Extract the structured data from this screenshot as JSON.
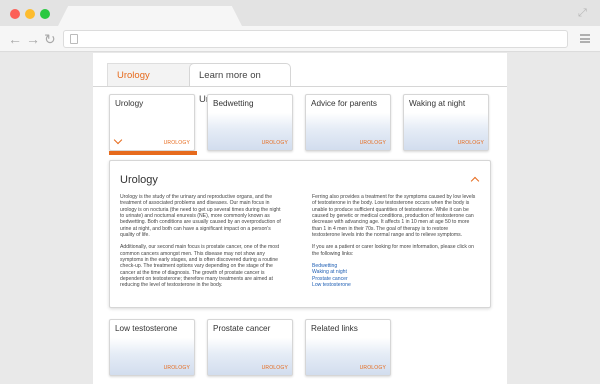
{
  "browser": {
    "window_controls": [
      "close",
      "minimize",
      "maximize"
    ]
  },
  "section_tabs": [
    {
      "label": "Urology products"
    },
    {
      "label": "Learn more on Urology"
    }
  ],
  "cards": [
    {
      "title": "Urology",
      "badge": "UROLOGY"
    },
    {
      "title": "Bedwetting",
      "badge": "UROLOGY"
    },
    {
      "title": "Advice for parents",
      "badge": "UROLOGY"
    },
    {
      "title": "Waking at night",
      "badge": "UROLOGY"
    },
    {
      "title": "Low testosterone",
      "badge": "UROLOGY"
    },
    {
      "title": "Prostate cancer",
      "badge": "UROLOGY"
    },
    {
      "title": "Related links",
      "badge": "UROLOGY"
    }
  ],
  "panel": {
    "title": "Urology",
    "left_p1": "Urology is the study of the urinary and reproductive organs, and the treatment of associated problems and diseases. Our main focus in urology is on nocturia (the need to get up several times during the night to urinate) and nocturnal enuresis (NE), more commonly known as bedwetting. Both conditions are usually caused by an overproduction of urine at night, and both can have a significant impact on a person's quality of life.",
    "left_p2": "Additionally, our second main focus is prostate cancer, one of the most common cancers amongst men. This disease may not show any symptoms in the early stages, and is often discovered during a routine check-up. The treatment options vary depending on the stage of the cancer at the time of diagnosis. The growth of prostate cancer is dependent on testosterone; therefore many treatments are aimed at reducing the level of testosterone in the body.",
    "right_p1": "Ferring also provides a treatment for the symptoms caused by low levels of testosterone in the body. Low testosterone occurs when the body is unable to produce sufficient quantities of testosterone. While it can be caused by genetic or medical conditions, production of testosterone can decrease with advancing age. It affects 1 in 10 men at age 50 to more than 1 in 4 men in their 70s. The goal of therapy is to restore testosterone levels into the normal range and to relieve symptoms.",
    "right_p2": "If you are a patient or carer looking for more information, please click on the following links:",
    "links": [
      "Bedwetting",
      "Waking at night",
      "Prostate cancer",
      "Low testosterone"
    ]
  },
  "colors": {
    "accent": "#e66a1c",
    "link": "#1f5fb4",
    "card_gradient_bottom": "#d2ddee"
  }
}
